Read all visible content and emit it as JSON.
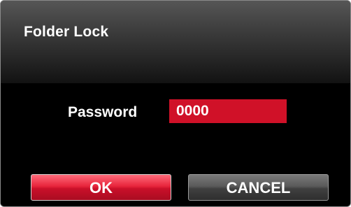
{
  "dialog": {
    "title": "Folder Lock"
  },
  "password": {
    "label": "Password",
    "value": "0000"
  },
  "buttons": {
    "ok_label": "OK",
    "cancel_label": "CANCEL"
  },
  "colors": {
    "accent": "#d01128",
    "background": "#000000",
    "cancel": "#4a4a4a"
  }
}
